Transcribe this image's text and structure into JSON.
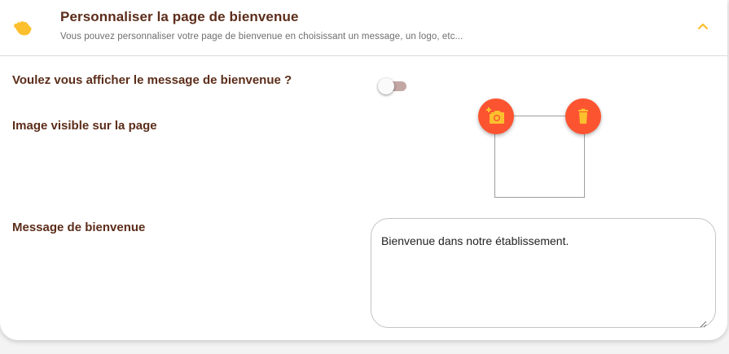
{
  "header": {
    "title": "Personnaliser la page de bienvenue",
    "subtitle": "Vous pouvez personnaliser votre page de bienvenue en choisissant un message, un logo, etc...",
    "icon": "waving-hand-icon",
    "collapse_icon": "chevron-up-icon"
  },
  "form": {
    "welcome_toggle": {
      "label": "Voulez vous afficher le message de bienvenue ?",
      "checked": false
    },
    "image": {
      "label": "Image visible sur la page",
      "add_icon": "add-photo-icon",
      "delete_icon": "trash-icon"
    },
    "message": {
      "label": "Message de bienvenue",
      "value": "Bienvenue dans notre établissement."
    }
  },
  "colors": {
    "accent": "#fc5430",
    "icon_yellow": "#fcc02e",
    "label_brown": "#5c2d1a",
    "toggle_track": "#c2a7a4"
  }
}
